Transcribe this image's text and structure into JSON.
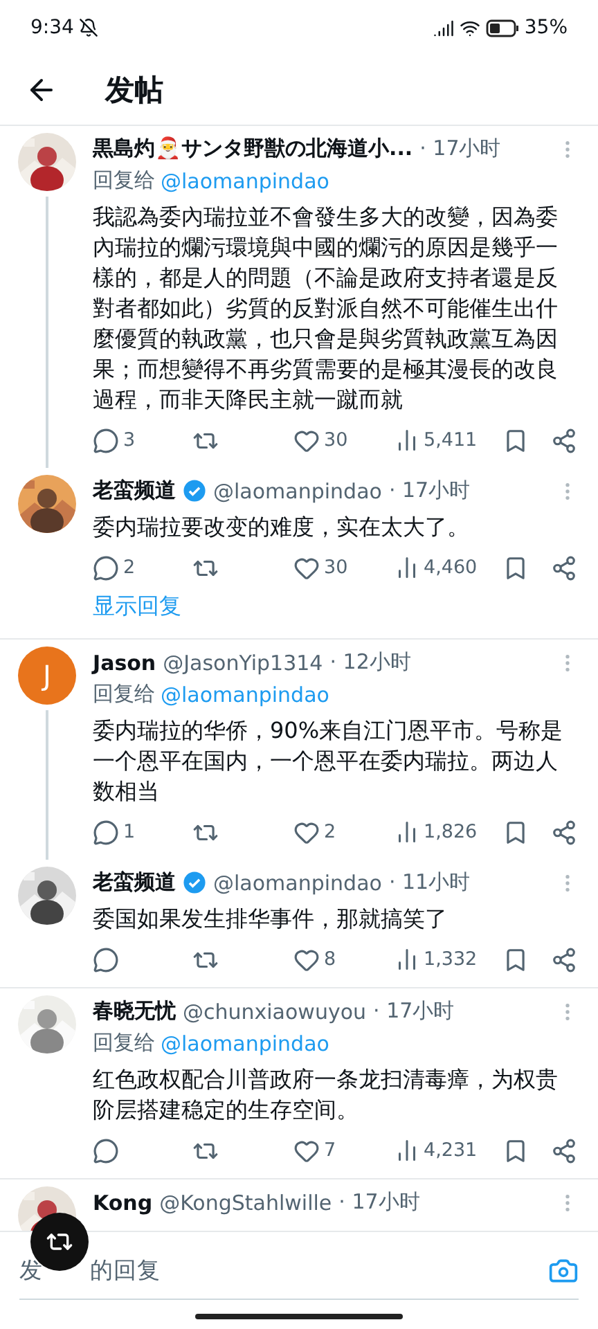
{
  "status_bar": {
    "time": "9:34",
    "battery": "35%"
  },
  "header": {
    "title": "发帖"
  },
  "tweets": [
    {
      "name": "黒島灼🎅サンタ野獣の北海道小...",
      "verified": false,
      "time": "· 17小时",
      "reply_label": "回复给",
      "reply_to": "@laomanpindao",
      "text": "我認為委內瑞拉並不會發生多大的改變，因為委內瑞拉的爛污環境與中國的爛污的原因是幾乎一樣的，都是人的問題（不論是政府支持者還是反對者都如此）劣質的反對派自然不可能催生出什麼優質的執政黨，也只會是與劣質執政黨互為因果；而想變得不再劣質需要的是極其漫長的改良過程，而非天降民主就一蹴而就",
      "replies": "3",
      "likes": "30",
      "views": "5,411",
      "thread_line": true,
      "divider": false
    },
    {
      "name": "老蛮频道",
      "verified": true,
      "handle": "@laomanpindao",
      "time": "· 17小时",
      "text": "委内瑞拉要改变的难度，实在太大了。",
      "replies": "2",
      "likes": "30",
      "views": "4,460",
      "thread_line": false,
      "show_replies": "显示回复",
      "divider": true
    },
    {
      "avatar": {
        "kind": "letter",
        "letter": "J",
        "color": "#e8741c"
      },
      "name": "Jason",
      "verified": false,
      "handle": "@JasonYip1314",
      "time": "· 12小时",
      "reply_label": "回复给",
      "reply_to": "@laomanpindao",
      "text": "委内瑞拉的华侨，90%来自江门恩平市。号称是一个恩平在国内，一个恩平在委内瑞拉。两边人数相当",
      "replies": "1",
      "likes": "2",
      "views": "1,826",
      "thread_line": true,
      "divider": false
    },
    {
      "name": "老蛮频道",
      "verified": true,
      "handle": "@laomanpindao",
      "time": "· 11小时",
      "text": "委国如果发生排华事件，那就搞笑了",
      "likes": "8",
      "views": "1,332",
      "thread_line": false,
      "divider": true
    },
    {
      "name": "春晓无忧",
      "verified": false,
      "handle": "@chunxiaowuyou",
      "time": "· 17小时",
      "reply_label": "回复给",
      "reply_to": "@laomanpindao",
      "text": "红色政权配合川普政府一条龙扫清毒瘴，为权贵阶层搭建稳定的生存空间。",
      "likes": "7",
      "views": "4,231",
      "thread_line": false,
      "divider": true
    },
    {
      "name": "Kong",
      "verified": false,
      "handle": "@KongStahlwille",
      "time": "· 17小时",
      "thread_line": false,
      "divider": false
    }
  ],
  "reply_bar": {
    "placeholder_parts": [
      "发",
      "的回复"
    ]
  }
}
